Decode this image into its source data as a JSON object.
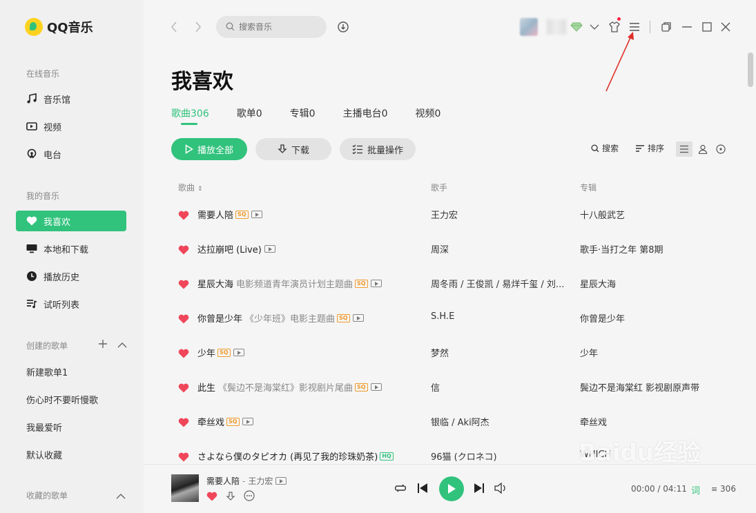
{
  "app": {
    "name": "QQ音乐"
  },
  "search": {
    "placeholder": "搜索音乐"
  },
  "sidebar": {
    "online_title": "在线音乐",
    "online_items": [
      "音乐馆",
      "视频",
      "电台"
    ],
    "my_title": "我的音乐",
    "my_items": [
      "我喜欢",
      "本地和下载",
      "播放历史",
      "试听列表"
    ],
    "created_title": "创建的歌单",
    "created_items": [
      "新建歌单1",
      "伤心时不要听慢歌",
      "我最爱听",
      "默认收藏"
    ],
    "collected_title": "收藏的歌单"
  },
  "main": {
    "title": "我喜欢",
    "tabs": [
      "歌曲306",
      "歌单0",
      "专辑0",
      "主播电台0",
      "视频0"
    ],
    "buttons": {
      "play_all": "播放全部",
      "download": "下载",
      "batch": "批量操作"
    },
    "tools": {
      "search": "搜索",
      "sort": "排序"
    },
    "columns": {
      "song": "歌曲",
      "singer": "歌手",
      "album": "专辑"
    },
    "songs": [
      {
        "title": "需要人陪",
        "subtitle": "",
        "badge": "SQ",
        "singer": "王力宏",
        "album": "十八般武艺"
      },
      {
        "title": "达拉崩吧 (Live)",
        "subtitle": "",
        "badge": "",
        "singer": "周深",
        "album": "歌手·当打之年 第8期"
      },
      {
        "title": "星辰大海",
        "subtitle": "电影频道青年演员计划主题曲",
        "badge": "SQ",
        "singer": "周冬雨 / 王俊凯 / 易烊千玺 / 刘...",
        "album": "星辰大海"
      },
      {
        "title": "你曾是少年",
        "subtitle": "《少年班》电影主题曲",
        "badge": "SQ",
        "singer": "S.H.E",
        "album": "你曾是少年"
      },
      {
        "title": "少年",
        "subtitle": "",
        "badge": "SQ",
        "singer": "梦然",
        "album": "少年"
      },
      {
        "title": "此生",
        "subtitle": "《鬓边不是海棠红》影视剧片尾曲",
        "badge": "SQ",
        "singer": "信",
        "album": "鬓边不是海棠红 影视剧原声带"
      },
      {
        "title": "牵丝戏",
        "subtitle": "",
        "badge": "SQ",
        "singer": "银临 / Aki阿杰",
        "album": "牵丝戏"
      },
      {
        "title": "さよなら僕のタピオカ (再见了我的珍珠奶茶)",
        "subtitle": "",
        "badge": "HQ",
        "singer": "96猫 (クロネコ)",
        "album": "WHICH"
      }
    ]
  },
  "player": {
    "title": "需要人陪",
    "separator": "-",
    "artist": "王力宏",
    "time": "00:00 / 04:11",
    "lyric": "词",
    "count": "306"
  },
  "watermark": "Baidu经验"
}
